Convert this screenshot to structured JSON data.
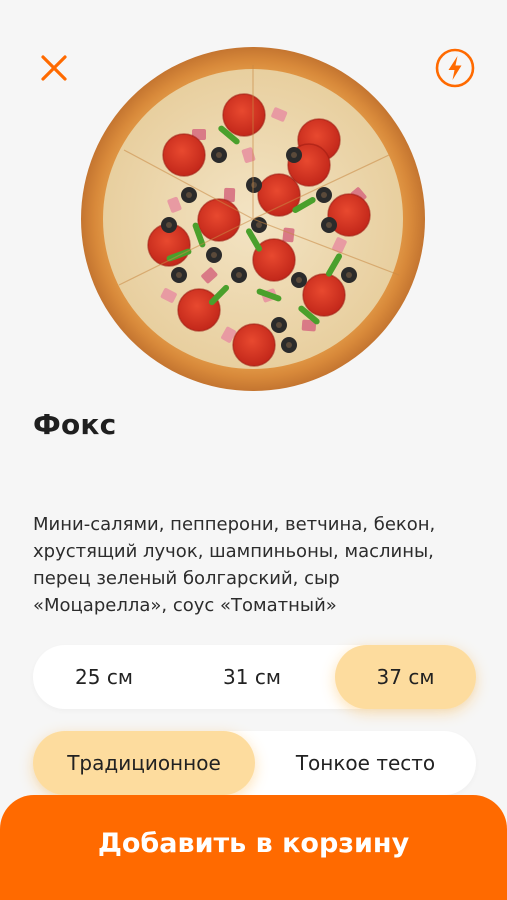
{
  "colors": {
    "accent": "#ff6a00",
    "selected_option": "#fddc9e",
    "background": "#f6f6f6"
  },
  "header": {
    "close_icon": "close-icon",
    "quick_icon": "lightning-bolt-icon"
  },
  "product": {
    "image_icon": "pizza-image",
    "title": "Фокс",
    "description": "Мини-салями, пепперони, ветчина, бекон, хрустящий лучок, шампиньоны, маслины, перец зеленый болгарский, сыр «Моцарелла», соус «Томатный»"
  },
  "sizes": {
    "selected": "37 см",
    "options": [
      {
        "label": "25 см"
      },
      {
        "label": "31 см"
      },
      {
        "label": "37 см"
      }
    ]
  },
  "dough": {
    "selected": "Традиционное",
    "options": [
      {
        "label": "Традиционное"
      },
      {
        "label": "Тонкое тесто"
      }
    ]
  },
  "cart": {
    "add_label": "Добавить в корзину"
  }
}
